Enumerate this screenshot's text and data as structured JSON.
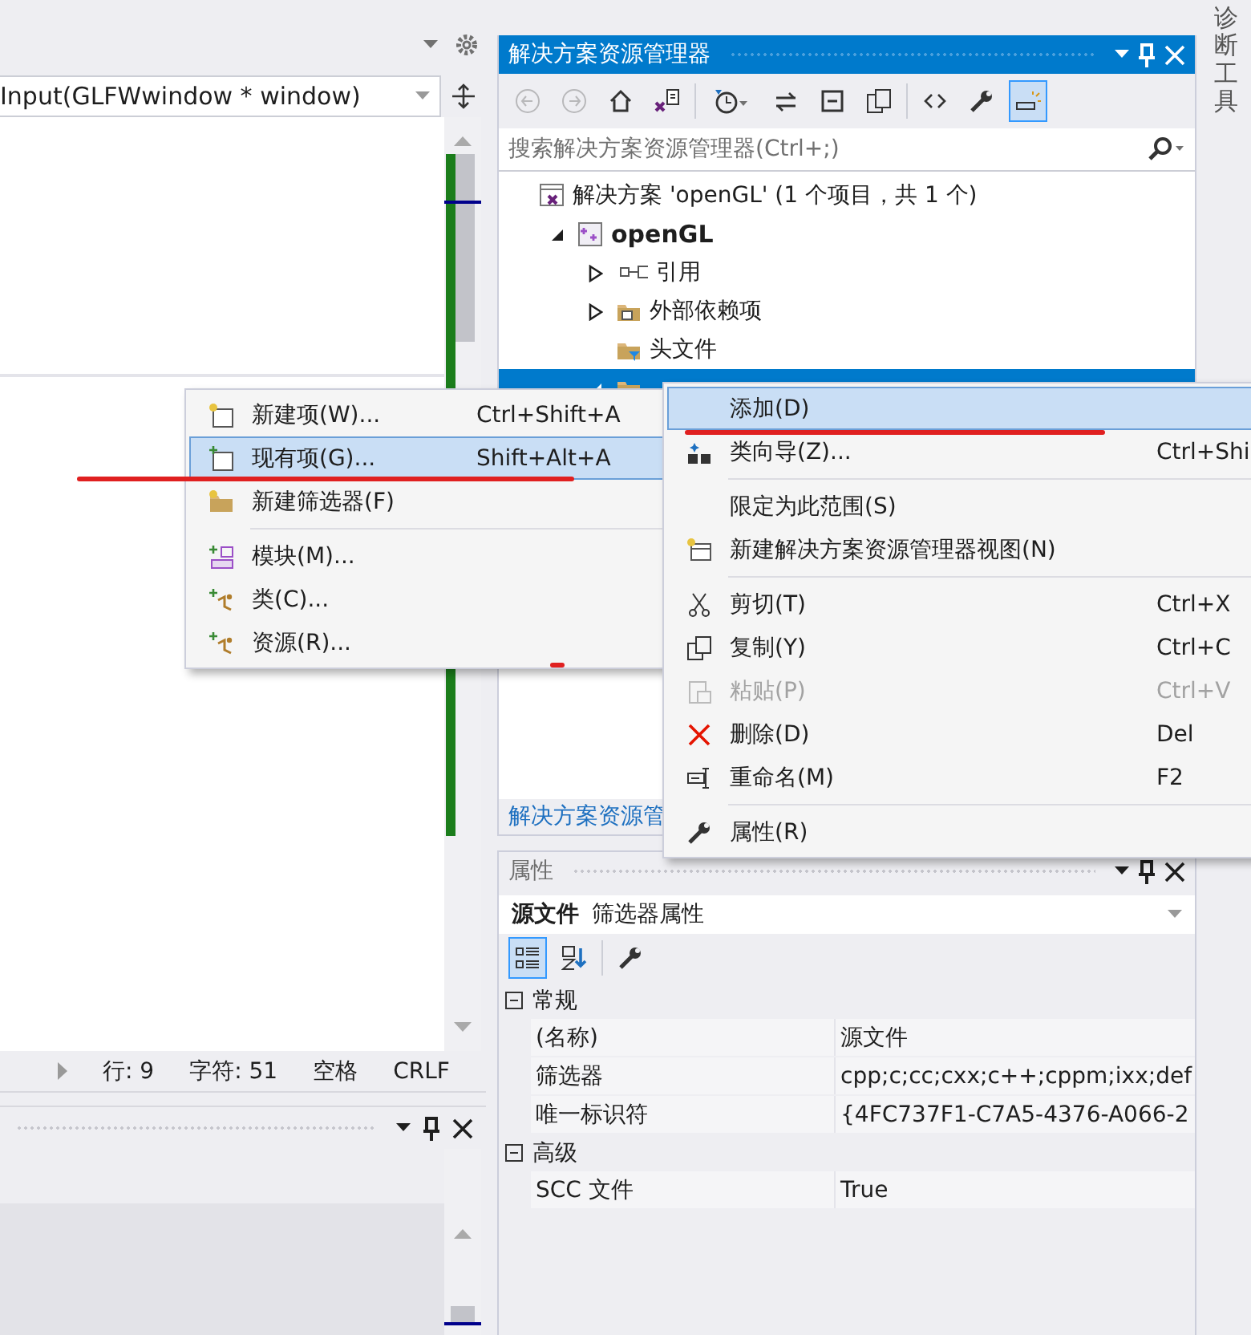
{
  "editor": {
    "nav_dropdown": "Input(GLFWwindow * window)",
    "status": {
      "line": "行: 9",
      "column": "字符: 51",
      "indent": "空格",
      "line_ending": "CRLF"
    }
  },
  "solution_explorer": {
    "title": "解决方案资源管理器",
    "toolbar": [
      {
        "disabled": true,
        "selected": false
      },
      {
        "disabled": true,
        "selected": false
      },
      {
        "disabled": false,
        "selected": false
      },
      {
        "disabled": false,
        "selected": false
      },
      {
        "disabled": false,
        "selected": false
      },
      {
        "disabled": false,
        "selected": false
      },
      {
        "disabled": false,
        "selected": false
      },
      {
        "disabled": false,
        "selected": false
      },
      {
        "disabled": false,
        "selected": false
      },
      {
        "disabled": false,
        "selected": false
      },
      {
        "disabled": false,
        "selected": true
      }
    ],
    "search": {
      "placeholder": "搜索解决方案资源管理器(Ctrl+;)"
    },
    "tree": [
      {
        "kind": "solution",
        "label": "解决方案 'openGL' (1 个项目，共 1 个)",
        "selected": false,
        "children": [
          {
            "kind": "project",
            "label": "openGL",
            "selected": false,
            "expanded": true,
            "children": [
              {
                "kind": "references",
                "label": "引用",
                "selected": false,
                "expanded": false
              },
              {
                "kind": "external",
                "label": "外部依赖项",
                "selected": false,
                "expanded": false
              },
              {
                "kind": "filter",
                "label": "头文件",
                "selected": false
              },
              {
                "kind": "filter",
                "selected": true,
                "expanded": true
              }
            ]
          }
        ]
      }
    ],
    "footer_tab": "解决方案资源管"
  },
  "context_menu": {
    "items": [
      {
        "kind": "submenu",
        "label": "添加(D)",
        "selected": true,
        "disabled": false
      },
      {
        "kind": "item",
        "label": "类向导(Z)...",
        "shortcut": "Ctrl+Shi",
        "selected": false,
        "disabled": false
      },
      {
        "kind": "separator"
      },
      {
        "kind": "item",
        "label": "限定为此范围(S)",
        "selected": false,
        "disabled": false
      },
      {
        "kind": "item",
        "label": "新建解决方案资源管理器视图(N)",
        "selected": false,
        "disabled": false
      },
      {
        "kind": "separator"
      },
      {
        "kind": "item",
        "label": "剪切(T)",
        "shortcut": "Ctrl+X",
        "selected": false,
        "disabled": false
      },
      {
        "kind": "item",
        "label": "复制(Y)",
        "shortcut": "Ctrl+C",
        "selected": false,
        "disabled": false
      },
      {
        "kind": "item",
        "label": "粘贴(P)",
        "shortcut": "Ctrl+V",
        "selected": false,
        "disabled": true
      },
      {
        "kind": "item",
        "label": "删除(D)",
        "shortcut": "Del",
        "selected": false,
        "disabled": false
      },
      {
        "kind": "item",
        "label": "重命名(M)",
        "shortcut": "F2",
        "selected": false,
        "disabled": false
      },
      {
        "kind": "separator"
      },
      {
        "kind": "item",
        "label": "属性(R)",
        "selected": false,
        "disabled": false
      }
    ]
  },
  "add_submenu": {
    "items": [
      {
        "kind": "item",
        "label": "新建项(W)...",
        "shortcut": "Ctrl+Shift+A",
        "selected": false
      },
      {
        "kind": "item",
        "label": "现有项(G)...",
        "shortcut": "Shift+Alt+A",
        "selected": true
      },
      {
        "kind": "item",
        "label": "新建筛选器(F)",
        "selected": false
      },
      {
        "kind": "separator"
      },
      {
        "kind": "item",
        "label": "模块(M)...",
        "selected": false
      },
      {
        "kind": "item",
        "label": "类(C)...",
        "selected": false
      },
      {
        "kind": "item",
        "label": "资源(R)...",
        "selected": false
      }
    ]
  },
  "properties": {
    "title": "属性",
    "object_name": "源文件",
    "object_type": "筛选器属性",
    "toolbar": [
      {
        "selected": true
      },
      {
        "selected": false
      },
      {
        "selected": false
      }
    ],
    "categories": [
      {
        "name": "常规",
        "expanded": true,
        "rows": [
          {
            "name": "(名称)",
            "value": "源文件"
          },
          {
            "name": "筛选器",
            "value": "cpp;c;cc;cxx;c++;cppm;ixx;def"
          },
          {
            "name": "唯一标识符",
            "value": "{4FC737F1-C7A5-4376-A066-2"
          }
        ]
      },
      {
        "name": "高级",
        "expanded": true,
        "rows": [
          {
            "name": "SCC 文件",
            "value": "True"
          }
        ]
      }
    ]
  },
  "side_tab": "诊断工具"
}
